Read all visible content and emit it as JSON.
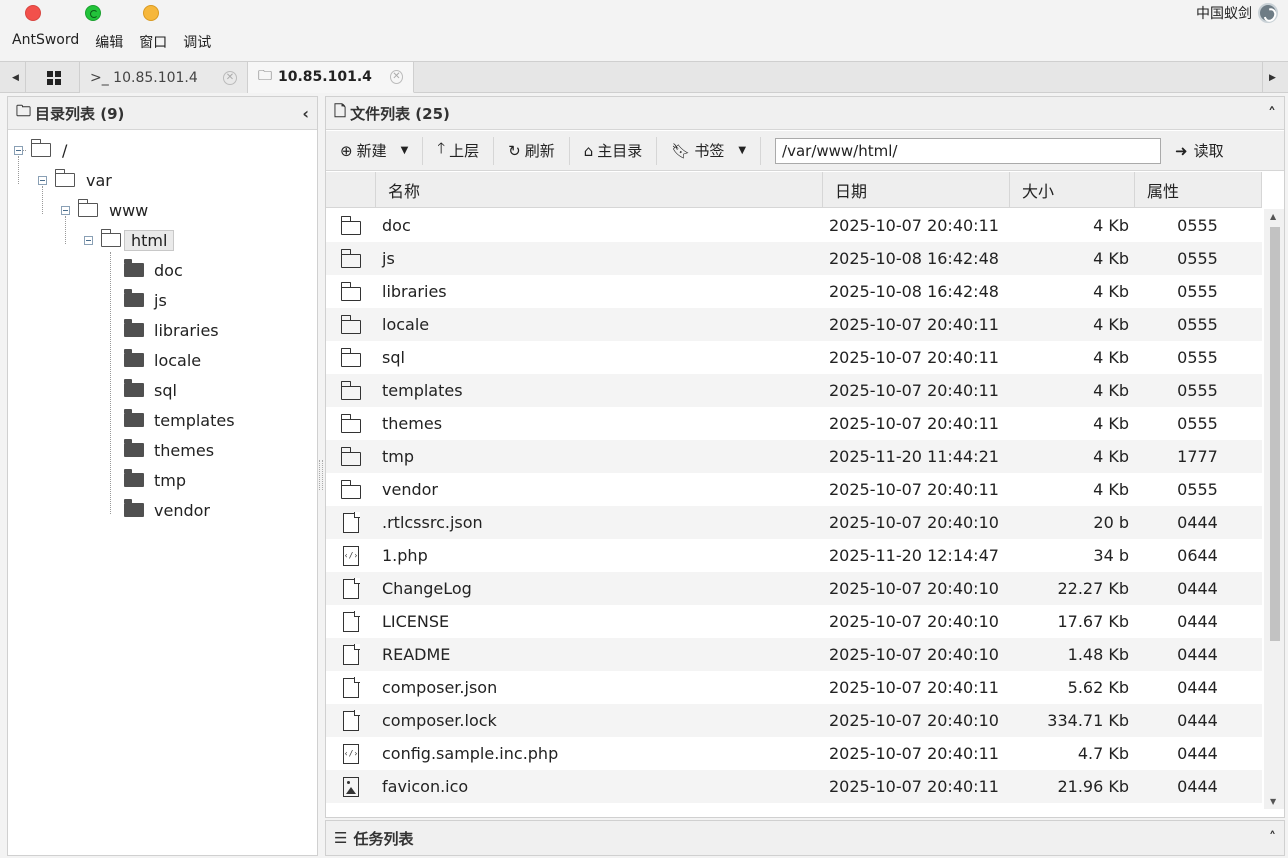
{
  "window": {
    "brand": "中国蚁剑"
  },
  "menu": [
    "AntSword",
    "编辑",
    "窗口",
    "调试"
  ],
  "tabs": [
    {
      "label": ">_ 10.85.101.4",
      "active": false
    },
    {
      "label": "10.85.101.4",
      "active": true
    }
  ],
  "dir_panel": {
    "title": "目录列表 (9)",
    "tree": {
      "root": "/",
      "var": "var",
      "www": "www",
      "html": "html",
      "children": [
        "doc",
        "js",
        "libraries",
        "locale",
        "sql",
        "templates",
        "themes",
        "tmp",
        "vendor"
      ]
    }
  },
  "file_panel": {
    "title": "文件列表 (25)",
    "toolbar": {
      "new": "新建",
      "up": "上层",
      "refresh": "刷新",
      "home": "主目录",
      "bookmark": "书签",
      "path": "/var/www/html/",
      "read": "读取"
    },
    "columns": [
      "名称",
      "日期",
      "大小",
      "属性"
    ],
    "rows": [
      {
        "icon": "folder",
        "name": "doc",
        "date": "2025-10-07 20:40:11",
        "size": "4 Kb",
        "attr": "0555"
      },
      {
        "icon": "folder",
        "name": "js",
        "date": "2025-10-08 16:42:48",
        "size": "4 Kb",
        "attr": "0555"
      },
      {
        "icon": "folder",
        "name": "libraries",
        "date": "2025-10-08 16:42:48",
        "size": "4 Kb",
        "attr": "0555"
      },
      {
        "icon": "folder",
        "name": "locale",
        "date": "2025-10-07 20:40:11",
        "size": "4 Kb",
        "attr": "0555"
      },
      {
        "icon": "folder",
        "name": "sql",
        "date": "2025-10-07 20:40:11",
        "size": "4 Kb",
        "attr": "0555"
      },
      {
        "icon": "folder",
        "name": "templates",
        "date": "2025-10-07 20:40:11",
        "size": "4 Kb",
        "attr": "0555"
      },
      {
        "icon": "folder",
        "name": "themes",
        "date": "2025-10-07 20:40:11",
        "size": "4 Kb",
        "attr": "0555"
      },
      {
        "icon": "folder",
        "name": "tmp",
        "date": "2025-11-20 11:44:21",
        "size": "4 Kb",
        "attr": "1777"
      },
      {
        "icon": "folder",
        "name": "vendor",
        "date": "2025-10-07 20:40:11",
        "size": "4 Kb",
        "attr": "0555"
      },
      {
        "icon": "file",
        "name": ".rtlcssrc.json",
        "date": "2025-10-07 20:40:10",
        "size": "20 b",
        "attr": "0444"
      },
      {
        "icon": "code",
        "name": "1.php",
        "date": "2025-11-20 12:14:47",
        "size": "34 b",
        "attr": "0644"
      },
      {
        "icon": "file",
        "name": "ChangeLog",
        "date": "2025-10-07 20:40:10",
        "size": "22.27 Kb",
        "attr": "0444"
      },
      {
        "icon": "file",
        "name": "LICENSE",
        "date": "2025-10-07 20:40:10",
        "size": "17.67 Kb",
        "attr": "0444"
      },
      {
        "icon": "file",
        "name": "README",
        "date": "2025-10-07 20:40:10",
        "size": "1.48 Kb",
        "attr": "0444"
      },
      {
        "icon": "file",
        "name": "composer.json",
        "date": "2025-10-07 20:40:11",
        "size": "5.62 Kb",
        "attr": "0444"
      },
      {
        "icon": "file",
        "name": "composer.lock",
        "date": "2025-10-07 20:40:10",
        "size": "334.71 Kb",
        "attr": "0444"
      },
      {
        "icon": "code",
        "name": "config.sample.inc.php",
        "date": "2025-10-07 20:40:11",
        "size": "4.7 Kb",
        "attr": "0444"
      },
      {
        "icon": "image",
        "name": "favicon.ico",
        "date": "2025-10-07 20:40:11",
        "size": "21.96 Kb",
        "attr": "0444"
      }
    ]
  },
  "task_panel": {
    "title": "任务列表"
  }
}
